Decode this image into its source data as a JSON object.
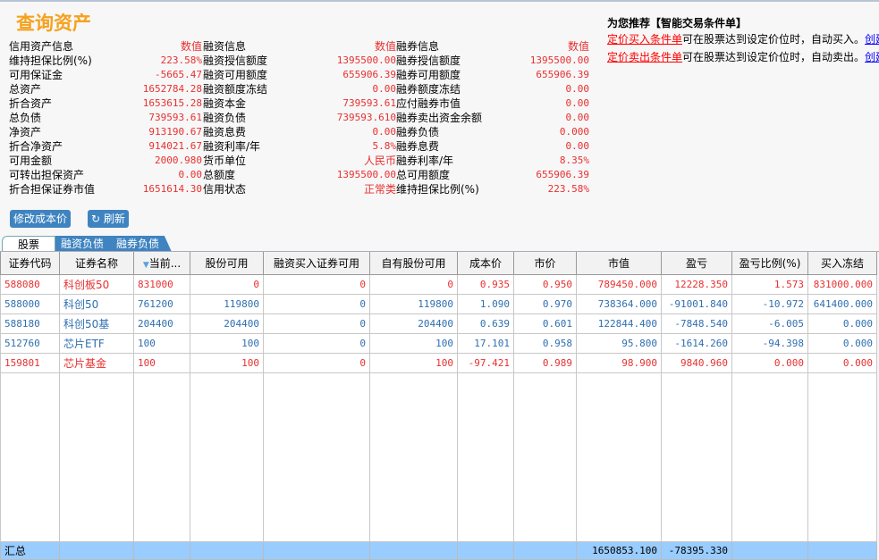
{
  "title": "查询资产",
  "info_columns": [
    {
      "header": {
        "label": "信用资产信息",
        "value": "数值"
      },
      "rows": [
        {
          "label": "维持担保比例(%)",
          "value": "223.58%"
        },
        {
          "label": "可用保证金",
          "value": "-5665.47"
        },
        {
          "label": "总资产",
          "value": "1652784.28"
        },
        {
          "label": "折合资产",
          "value": "1653615.28"
        },
        {
          "label": "总负债",
          "value": "739593.61"
        },
        {
          "label": "净资产",
          "value": "913190.67"
        },
        {
          "label": "折合净资产",
          "value": "914021.67"
        },
        {
          "label": "可用金额",
          "value": "2000.980"
        },
        {
          "label": "可转出担保资产",
          "value": "0.00"
        },
        {
          "label": "折合担保证券市值",
          "value": "1651614.30"
        }
      ]
    },
    {
      "header": {
        "label": "融资信息",
        "value": "数值"
      },
      "rows": [
        {
          "label": "融资授信额度",
          "value": "1395500.00"
        },
        {
          "label": "融资可用额度",
          "value": "655906.39"
        },
        {
          "label": "融资额度冻结",
          "value": "0.00"
        },
        {
          "label": "融资本金",
          "value": "739593.61"
        },
        {
          "label": "融资负债",
          "value": "739593.610"
        },
        {
          "label": "融资息费",
          "value": "0.00"
        },
        {
          "label": "融资利率/年",
          "value": "5.8%"
        },
        {
          "label": "货币单位",
          "value": "人民币"
        },
        {
          "label": "总额度",
          "value": "1395500.00"
        },
        {
          "label": "信用状态",
          "value": "正常类"
        }
      ]
    },
    {
      "header": {
        "label": "融券信息",
        "value": "数值"
      },
      "rows": [
        {
          "label": "融券授信额度",
          "value": "1395500.00"
        },
        {
          "label": "融券可用额度",
          "value": "655906.39"
        },
        {
          "label": "融券额度冻结",
          "value": "0.00"
        },
        {
          "label": "应付融券市值",
          "value": "0.00"
        },
        {
          "label": "融券卖出资金余额",
          "value": "0.00"
        },
        {
          "label": "融券负债",
          "value": "0.000"
        },
        {
          "label": "融券息费",
          "value": "0.00"
        },
        {
          "label": "融券利率/年",
          "value": "8.35%"
        },
        {
          "label": "总可用额度",
          "value": "655906.39"
        },
        {
          "label": "维持担保比例(%)",
          "value": "223.58%"
        }
      ]
    }
  ],
  "recommend": {
    "title": "为您推荐【智能交易条件单】",
    "items": [
      {
        "link": "定价买入条件单",
        "text": "可在股票达到设定价位时，自动买入。",
        "action": "创建"
      },
      {
        "link": "定价卖出条件单",
        "text": "可在股票达到设定价位时，自动卖出。",
        "action": "创建"
      }
    ]
  },
  "buttons": {
    "edit_cost": "修改成本价",
    "refresh": "刷新"
  },
  "tabs": [
    "股票",
    "融资负债",
    "融券负债"
  ],
  "table": {
    "columns": [
      "证券代码",
      "证券名称",
      "当前...",
      "股份可用",
      "融资买入证券可用",
      "自有股份可用",
      "成本价",
      "市价",
      "市值",
      "盈亏",
      "盈亏比例(%)",
      "买入冻结"
    ],
    "rows": [
      {
        "color": "red",
        "cells": [
          "588080",
          "科创板50",
          "831000",
          "0",
          "0",
          "0",
          "0.935",
          "0.950",
          "789450.000",
          "12228.350",
          "1.573",
          "831000.000"
        ]
      },
      {
        "color": "blue",
        "cells": [
          "588000",
          "科创50",
          "761200",
          "119800",
          "0",
          "119800",
          "1.090",
          "0.970",
          "738364.000",
          "-91001.840",
          "-10.972",
          "641400.000"
        ]
      },
      {
        "color": "blue",
        "cells": [
          "588180",
          "科创50基",
          "204400",
          "204400",
          "0",
          "204400",
          "0.639",
          "0.601",
          "122844.400",
          "-7848.540",
          "-6.005",
          "0.000"
        ]
      },
      {
        "color": "blue",
        "cells": [
          "512760",
          "芯片ETF",
          "100",
          "100",
          "0",
          "100",
          "17.101",
          "0.958",
          "95.800",
          "-1614.260",
          "-94.398",
          "0.000"
        ]
      },
      {
        "color": "red",
        "cells": [
          "159801",
          "芯片基金",
          "100",
          "100",
          "0",
          "100",
          "-97.421",
          "0.989",
          "98.900",
          "9840.960",
          "0.000",
          "0.000"
        ]
      }
    ],
    "summary": {
      "label": "汇总",
      "market_value": "1650853.100",
      "profit": "-78395.330"
    }
  },
  "colors": {
    "red": "#e83030",
    "blue": "#2f6fb0",
    "accent": "#3f84c0",
    "summary": "#99ccff",
    "title": "#f5a21e"
  }
}
